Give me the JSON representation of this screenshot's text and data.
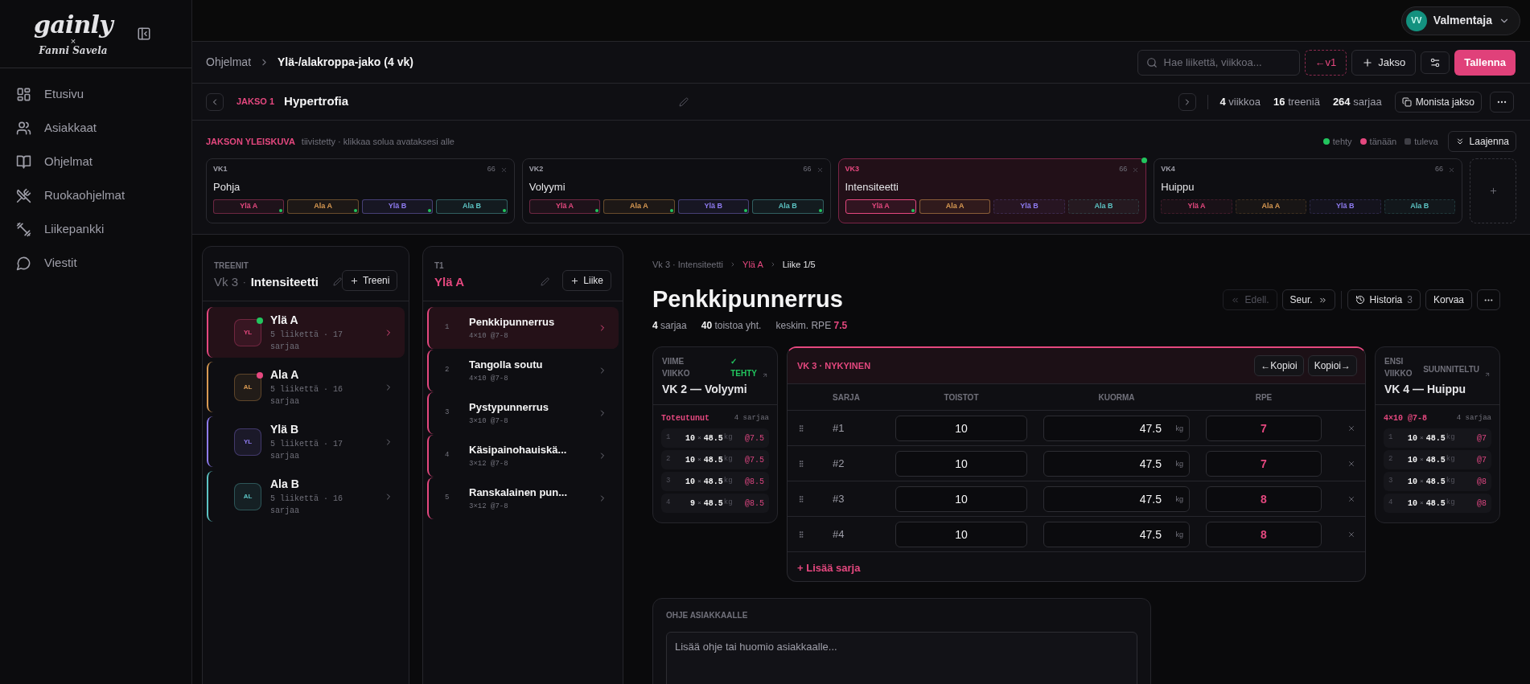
{
  "sidebar": {
    "logo": {
      "brand": "gainly",
      "cross": "×",
      "partner": "Fanni Savela"
    },
    "items": [
      {
        "label": "Etusivu"
      },
      {
        "label": "Asiakkaat"
      },
      {
        "label": "Ohjelmat"
      },
      {
        "label": "Ruokaohjelmat"
      },
      {
        "label": "Liikepankki"
      },
      {
        "label": "Viestit"
      }
    ]
  },
  "user": {
    "initials": "VV",
    "name": "Valmentaja"
  },
  "breadcrumb": {
    "parent": "Ohjelmat",
    "current": "Ylä-/alakroppa-jako (4 vk)"
  },
  "toolbar": {
    "search_placeholder": "Hae liikettä, viikkoa...",
    "version_button": "←v1",
    "add_button": "Jakso",
    "save_button": "Tallenna"
  },
  "period": {
    "tag": "JAKSO 1",
    "title": "Hypertrofia",
    "stats": [
      {
        "text": "**4** viikkoa"
      },
      {
        "text": "**16** treeniä"
      },
      {
        "text": "**264** sarjaa"
      }
    ],
    "copy_button": "Monista jakso"
  },
  "overview": {
    "title": "JAKSON YLEISKUVA",
    "hint": "tiivistetty · klikkaa solua avataksesi alle",
    "legend": [
      {
        "label": "tehty",
        "color": "#22c55e",
        "kind": "dot"
      },
      {
        "label": "tänään",
        "color": "#e5487f",
        "kind": "dot"
      },
      {
        "label": "tuleva",
        "color": "#3f3f46",
        "kind": "square"
      }
    ],
    "expand_button": "Laajenna",
    "weeks": [
      {
        "label": "VK1",
        "name": "Pohja",
        "count": "66",
        "selected": false,
        "done": false,
        "cells": [
          {
            "label": "Ylä A",
            "color": "#e5487f",
            "completed": true,
            "upcoming": false
          },
          {
            "label": "Ala A",
            "color": "#d99a52",
            "completed": true,
            "upcoming": false
          },
          {
            "label": "Ylä B",
            "color": "#8f7cf2",
            "completed": true,
            "upcoming": false
          },
          {
            "label": "Ala B",
            "color": "#5cc3c3",
            "completed": true,
            "upcoming": false
          }
        ]
      },
      {
        "label": "VK2",
        "name": "Volyymi",
        "count": "66",
        "selected": false,
        "done": false,
        "cells": [
          {
            "label": "Ylä A",
            "color": "#e5487f",
            "completed": true,
            "upcoming": false
          },
          {
            "label": "Ala A",
            "color": "#d99a52",
            "completed": true,
            "upcoming": false
          },
          {
            "label": "Ylä B",
            "color": "#8f7cf2",
            "completed": true,
            "upcoming": false
          },
          {
            "label": "Ala B",
            "color": "#5cc3c3",
            "completed": true,
            "upcoming": false
          }
        ]
      },
      {
        "label": "VK3",
        "name": "Intensiteetti",
        "count": "66",
        "selected": true,
        "done": true,
        "cells": [
          {
            "label": "Ylä A",
            "color": "#e5487f",
            "completed": true,
            "upcoming": false
          },
          {
            "label": "Ala A",
            "color": "#d99a52",
            "completed": false,
            "upcoming": false
          },
          {
            "label": "Ylä B",
            "color": "#8f7cf2",
            "completed": false,
            "upcoming": true
          },
          {
            "label": "Ala B",
            "color": "#5cc3c3",
            "completed": false,
            "upcoming": true
          }
        ]
      },
      {
        "label": "VK4",
        "name": "Huippu",
        "count": "66",
        "selected": false,
        "done": false,
        "cells": [
          {
            "label": "Ylä A",
            "color": "#e5487f",
            "completed": false,
            "upcoming": true
          },
          {
            "label": "Ala A",
            "color": "#d99a52",
            "completed": false,
            "upcoming": true
          },
          {
            "label": "Ylä B",
            "color": "#8f7cf2",
            "completed": false,
            "upcoming": true
          },
          {
            "label": "Ala B",
            "color": "#5cc3c3",
            "completed": false,
            "upcoming": true
          }
        ]
      }
    ]
  },
  "workouts_panel": {
    "heading": "TREENIT",
    "week": "Vk 3",
    "separator": "·",
    "week_name": "Intensiteetti",
    "add_button": "Treeni",
    "items": [
      {
        "initials": "YL",
        "name": "Ylä A",
        "meta": "5 liikettä · 17 sarjaa",
        "color": "#e5487f",
        "completed": true,
        "today": false,
        "selected": true
      },
      {
        "initials": "AL",
        "name": "Ala A",
        "meta": "5 liikettä · 16 sarjaa",
        "color": "#d99a52",
        "completed": false,
        "today": true,
        "selected": false
      },
      {
        "initials": "YL",
        "name": "Ylä B",
        "meta": "5 liikettä · 17 sarjaa",
        "color": "#8f7cf2",
        "completed": false,
        "today": false,
        "selected": false
      },
      {
        "initials": "AL",
        "name": "Ala B",
        "meta": "5 liikettä · 16 sarjaa",
        "color": "#5cc3c3",
        "completed": false,
        "today": false,
        "selected": false
      }
    ]
  },
  "exercises_panel": {
    "heading": "T1",
    "title": "Ylä A",
    "add_button": "Liike",
    "items": [
      {
        "number": "1",
        "name": "Penkkipunnerrus",
        "scheme": "4×10 @7-8",
        "selected": true
      },
      {
        "number": "2",
        "name": "Tangolla soutu",
        "scheme": "4×10 @7-8",
        "selected": false
      },
      {
        "number": "3",
        "name": "Pystypunnerrus",
        "scheme": "3×10 @7-8",
        "selected": false
      },
      {
        "number": "4",
        "name": "Käsipainohauiskä...",
        "scheme": "3×12 @7-8",
        "selected": false
      },
      {
        "number": "5",
        "name": "Ranskalainen pun...",
        "scheme": "3×12 @7-8",
        "selected": false
      }
    ]
  },
  "detail": {
    "crumbs": [
      {
        "label": "Vk 3 · Intensiteetti",
        "kind": "muted"
      },
      {
        "label": "Ylä A",
        "kind": "accent"
      },
      {
        "label": "Liike 1/5",
        "kind": "current"
      }
    ],
    "title": "Penkkipunnerrus",
    "stats": [
      {
        "text": "**4** sarjaa",
        "kind": "plain"
      },
      {
        "text": "**40** toistoa yht.",
        "kind": "plain"
      },
      {
        "text": "keskim. RPE **7.5**",
        "kind": "accent"
      }
    ],
    "prev_button": {
      "label": "Edell.",
      "disabled": true
    },
    "next_button": {
      "label": "Seur.",
      "disabled": false
    },
    "history_button": {
      "label": "Historia",
      "count": "3"
    },
    "replace_button": "Korvaa",
    "last_week": {
      "eyebrow": "VIIME VIIKKO",
      "status": {
        "mark": "✓",
        "label": "TEHTY",
        "kind": "done"
      },
      "title": "VK 2 — Volyymi",
      "summary": "Toteutunut",
      "count": "4 sarjaa",
      "rows": [
        {
          "number": "1",
          "reps": "10",
          "times": "×",
          "load": "48.5",
          "unit": "kg",
          "rpe": "@7.5"
        },
        {
          "number": "2",
          "reps": "10",
          "times": "×",
          "load": "48.5",
          "unit": "kg",
          "rpe": "@7.5"
        },
        {
          "number": "3",
          "reps": "10",
          "times": "×",
          "load": "48.5",
          "unit": "kg",
          "rpe": "@8.5"
        },
        {
          "number": "4",
          "reps": "9",
          "times": "×",
          "load": "48.5",
          "unit": "kg",
          "rpe": "@8.5"
        }
      ]
    },
    "current": {
      "title": "VK 3 · NYKYINEN",
      "copy_back": "←Kopioi",
      "copy_forward": "Kopioi→",
      "columns": [
        "SARJA",
        "TOISTOT",
        "KUORMA",
        "RPE"
      ],
      "sets": [
        {
          "label": "#1",
          "reps": "10",
          "load": "47.5",
          "unit": "kg",
          "rpe": "7"
        },
        {
          "label": "#2",
          "reps": "10",
          "load": "47.5",
          "unit": "kg",
          "rpe": "7"
        },
        {
          "label": "#3",
          "reps": "10",
          "load": "47.5",
          "unit": "kg",
          "rpe": "8"
        },
        {
          "label": "#4",
          "reps": "10",
          "load": "47.5",
          "unit": "kg",
          "rpe": "8"
        }
      ],
      "add_set": "+ Lisää sarja"
    },
    "next_week": {
      "eyebrow": "ENSI VIIKKO",
      "status": {
        "label": "SUUNNITELTU",
        "kind": "planned"
      },
      "title": "VK 4 — Huippu",
      "summary": "4×10 @7-8",
      "count": "4 sarjaa",
      "rows": [
        {
          "number": "1",
          "reps": "10",
          "times": "×",
          "load": "48.5",
          "unit": "kg",
          "rpe": "@7"
        },
        {
          "number": "2",
          "reps": "10",
          "times": "×",
          "load": "48.5",
          "unit": "kg",
          "rpe": "@7"
        },
        {
          "number": "3",
          "reps": "10",
          "times": "×",
          "load": "48.5",
          "unit": "kg",
          "rpe": "@8"
        },
        {
          "number": "4",
          "reps": "10",
          "times": "×",
          "load": "48.5",
          "unit": "kg",
          "rpe": "@8"
        }
      ]
    },
    "note": {
      "label": "OHJE ASIAKKAALLE",
      "placeholder": "Lisää ohje tai huomio asiakkaalle..."
    }
  }
}
